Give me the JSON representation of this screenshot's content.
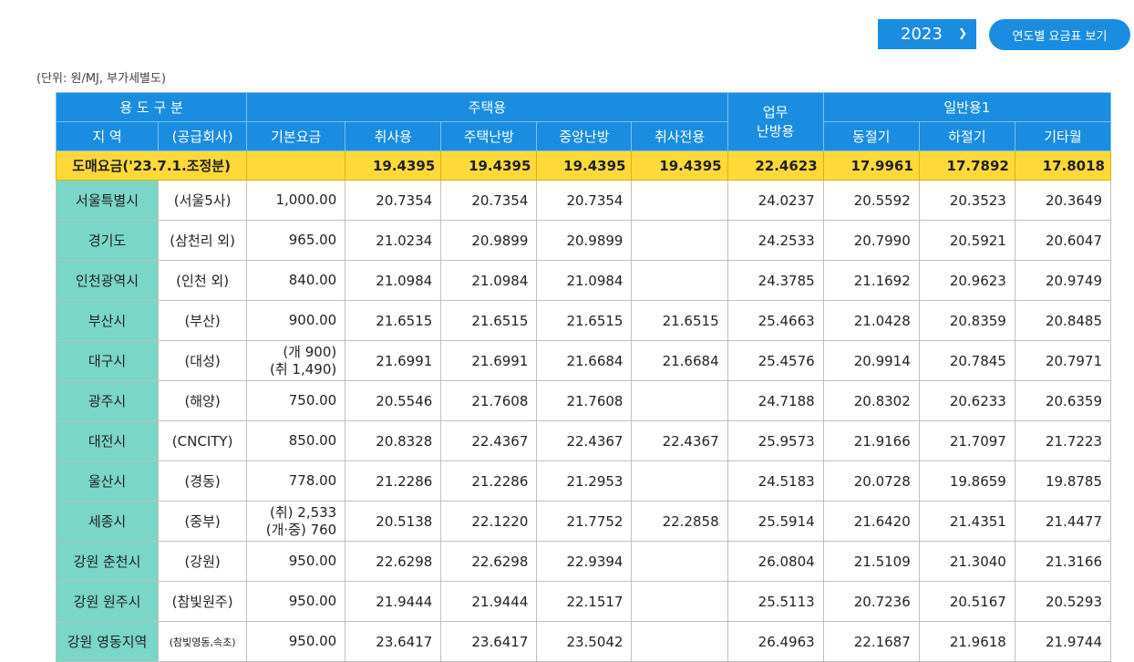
{
  "controls": {
    "year": "2023",
    "view_button": "연도별 요금표 보기"
  },
  "unit_note": "(단위: 원/MJ, 부가세별도)",
  "header": {
    "usage_type": "용 도 구 분",
    "residential": "주택용",
    "business_heating": "업무\n난방용",
    "general1": "일반용1",
    "region": "지 역",
    "supplier": "(공급회사)",
    "base_fee": "기본요금",
    "cooking": "취사용",
    "home_heating": "주택난방",
    "central_heating": "중앙난방",
    "cooking_only": "취사전용",
    "shoulder": "동절기",
    "summer": "하절기",
    "other_months": "기타월"
  },
  "wholesale": {
    "label": "도매요금('23.7.1.조정분)",
    "values": [
      "19.4395",
      "19.4395",
      "19.4395",
      "19.4395",
      "22.4623",
      "17.9961",
      "17.7892",
      "17.8018"
    ]
  },
  "rows": [
    {
      "region": "서울특별시",
      "company": "(서울5사)",
      "base": [
        "1,000.00"
      ],
      "values": [
        "20.7354",
        "20.7354",
        "20.7354",
        "",
        "24.0237",
        "20.5592",
        "20.3523",
        "20.3649"
      ]
    },
    {
      "region": "경기도",
      "company": "(삼천리 외)",
      "base": [
        "965.00"
      ],
      "values": [
        "21.0234",
        "20.9899",
        "20.9899",
        "",
        "24.2533",
        "20.7990",
        "20.5921",
        "20.6047"
      ]
    },
    {
      "region": "인천광역시",
      "company": "(인천 외)",
      "base": [
        "840.00"
      ],
      "values": [
        "21.0984",
        "21.0984",
        "21.0984",
        "",
        "24.3785",
        "21.1692",
        "20.9623",
        "20.9749"
      ]
    },
    {
      "region": "부산시",
      "company": "(부산)",
      "base": [
        "900.00"
      ],
      "values": [
        "21.6515",
        "21.6515",
        "21.6515",
        "21.6515",
        "25.4663",
        "21.0428",
        "20.8359",
        "20.8485"
      ]
    },
    {
      "region": "대구시",
      "company": "(대성)",
      "base": [
        "(개 900)",
        "(취 1,490)"
      ],
      "values": [
        "21.6991",
        "21.6991",
        "21.6684",
        "21.6684",
        "25.4576",
        "20.9914",
        "20.7845",
        "20.7971"
      ]
    },
    {
      "region": "광주시",
      "company": "(해양)",
      "base": [
        "750.00"
      ],
      "values": [
        "20.5546",
        "21.7608",
        "21.7608",
        "",
        "24.7188",
        "20.8302",
        "20.6233",
        "20.6359"
      ]
    },
    {
      "region": "대전시",
      "company": "(CNCITY)",
      "base": [
        "850.00"
      ],
      "values": [
        "20.8328",
        "22.4367",
        "22.4367",
        "22.4367",
        "25.9573",
        "21.9166",
        "21.7097",
        "21.7223"
      ]
    },
    {
      "region": "울산시",
      "company": "(경동)",
      "base": [
        "778.00"
      ],
      "values": [
        "21.2286",
        "21.2286",
        "21.2953",
        "",
        "24.5183",
        "20.0728",
        "19.8659",
        "19.8785"
      ]
    },
    {
      "region": "세종시",
      "company": "(중부)",
      "base": [
        "(취) 2,533",
        "(개·중) 760"
      ],
      "values": [
        "20.5138",
        "22.1220",
        "21.7752",
        "22.2858",
        "25.5914",
        "21.6420",
        "21.4351",
        "21.4477"
      ]
    },
    {
      "region": "강원 춘천시",
      "company": "(강원)",
      "base": [
        "950.00"
      ],
      "values": [
        "22.6298",
        "22.6298",
        "22.9394",
        "",
        "26.0804",
        "21.5109",
        "21.3040",
        "21.3166"
      ]
    },
    {
      "region": "강원 원주시",
      "company": "(참빛원주)",
      "base": [
        "950.00"
      ],
      "values": [
        "21.9444",
        "21.9444",
        "22.1517",
        "",
        "25.5113",
        "20.7236",
        "20.5167",
        "20.5293"
      ]
    },
    {
      "region": "강원 영동지역",
      "company": "(참빛영동,속초)",
      "base": [
        "950.00"
      ],
      "values": [
        "23.6417",
        "23.6417",
        "23.5042",
        "",
        "26.4963",
        "22.1687",
        "21.9618",
        "21.9744"
      ]
    }
  ]
}
